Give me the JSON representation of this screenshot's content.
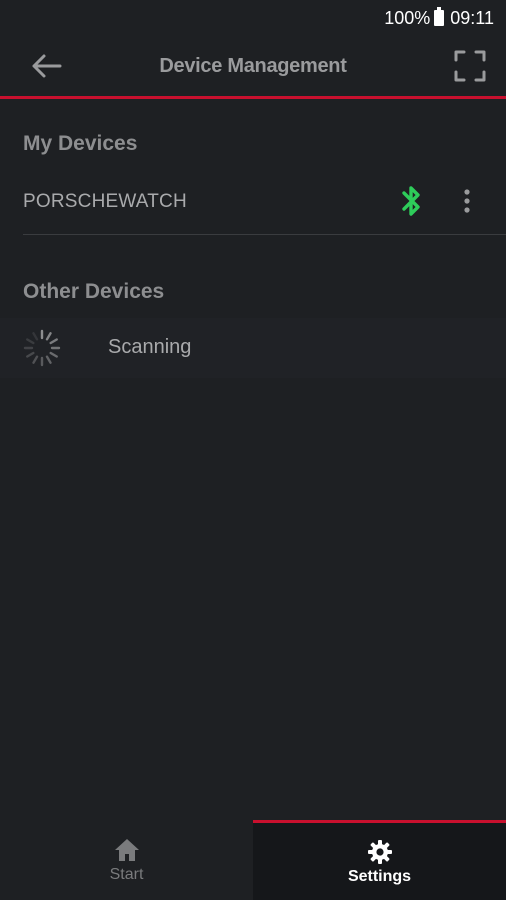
{
  "status_bar": {
    "battery": "100%",
    "time": "09:11"
  },
  "app_bar": {
    "title": "Device Management"
  },
  "my_devices": {
    "title": "My Devices",
    "devices": [
      {
        "name": "PORSCHEWATCH",
        "status_icon": "bluetooth-icon",
        "status_color": "#2ecc5a"
      }
    ]
  },
  "other_devices": {
    "title": "Other Devices",
    "scanning_label": "Scanning"
  },
  "bottom_nav": {
    "items": [
      {
        "label": "Start",
        "icon": "home-icon",
        "active": false
      },
      {
        "label": "Settings",
        "icon": "gear-icon",
        "active": true
      }
    ]
  },
  "colors": {
    "accent": "#c8102e",
    "background": "#1e2023",
    "bluetooth": "#2ecc5a"
  }
}
